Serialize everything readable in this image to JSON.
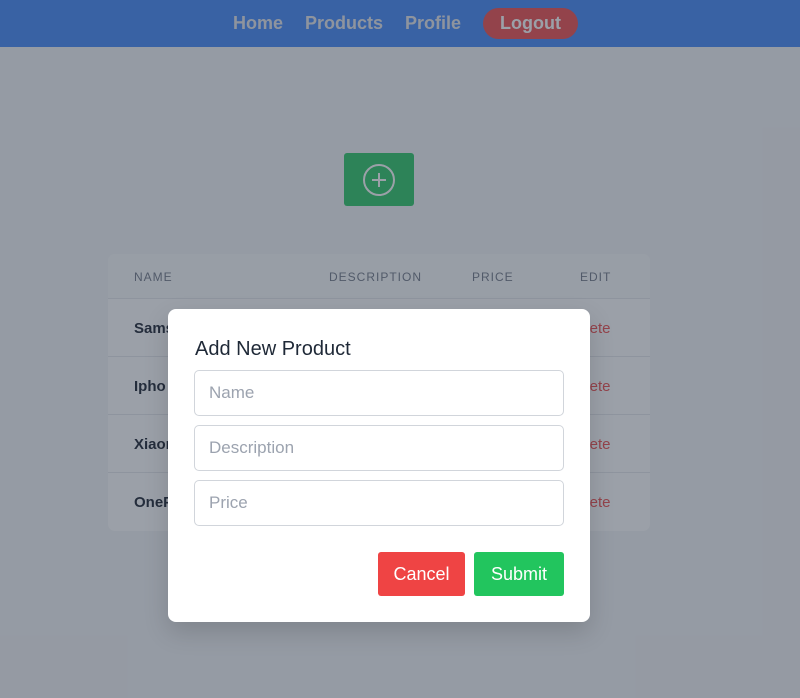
{
  "nav": {
    "links": [
      "Home",
      "Products",
      "Profile"
    ],
    "logout": "Logout"
  },
  "table": {
    "headers": [
      "NAME",
      "DESCRIPTION",
      "PRICE",
      "EDIT"
    ],
    "rows": [
      {
        "name": "Sams",
        "action": "elete"
      },
      {
        "name": "Ipho",
        "action": "elete"
      },
      {
        "name": "Xiaor",
        "action": "elete"
      },
      {
        "name": "OneP",
        "action": "elete"
      }
    ]
  },
  "modal": {
    "title": "Add New Product",
    "name_placeholder": "Name",
    "description_placeholder": "Description",
    "price_placeholder": "Price",
    "cancel_label": "Cancel",
    "submit_label": "Submit"
  },
  "icons": {
    "add": "plus-circle-icon"
  },
  "colors": {
    "navbar": "#3b82f6",
    "danger": "#ef4444",
    "success": "#22c55e"
  }
}
